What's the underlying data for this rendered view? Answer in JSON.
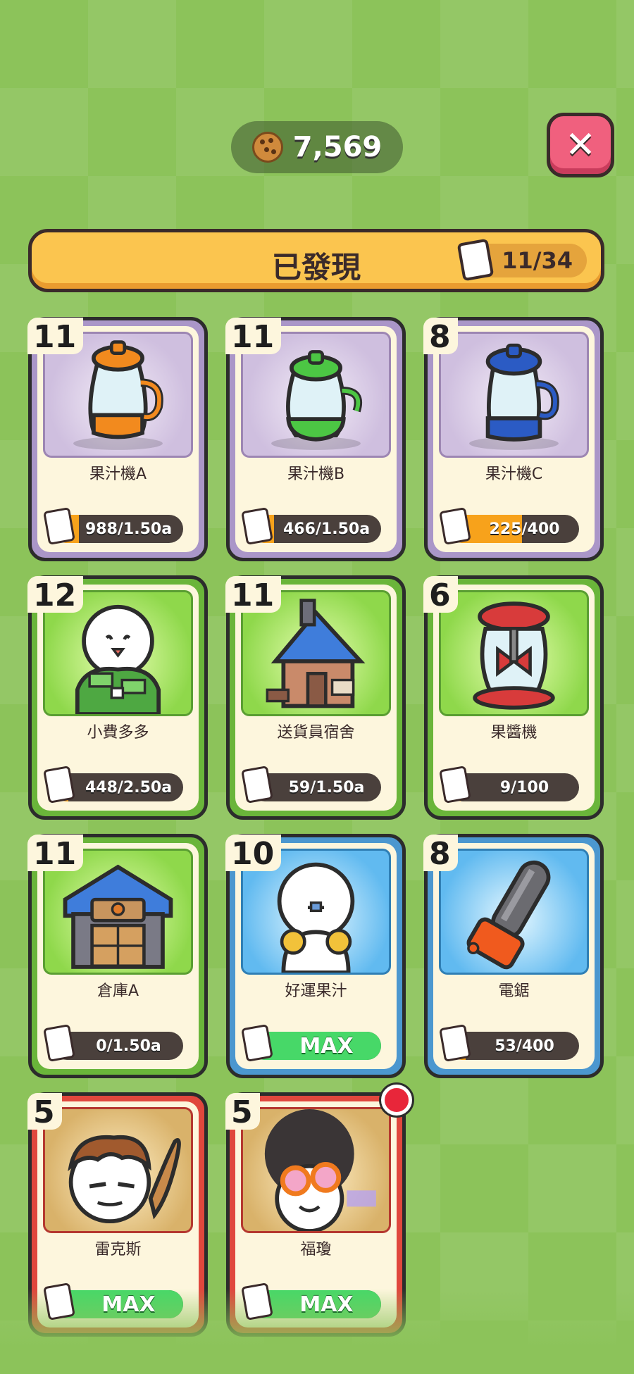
{
  "currency": {
    "icon": "cookie-icon",
    "value": "7,569"
  },
  "close_button": {
    "icon": "close-icon",
    "label": "✕"
  },
  "header": {
    "title": "已發現",
    "count": "11/34",
    "icon": "card-icon"
  },
  "colors": {
    "purple": "#aa96c8",
    "green": "#6ab53a",
    "blue": "#4b97cf",
    "red": "#e0473d",
    "progress": "#f7a21b",
    "max": "#47d868"
  },
  "cards": [
    {
      "level": "11",
      "name": "果汁機A",
      "progress_text": "988/1.50a",
      "progress": 0.2,
      "rarity": "purple",
      "icon": "juicer-orange-icon"
    },
    {
      "level": "11",
      "name": "果汁機B",
      "progress_text": "466/1.50a",
      "progress": 0.18,
      "rarity": "purple",
      "icon": "juicer-green-icon"
    },
    {
      "level": "8",
      "name": "果汁機C",
      "progress_text": "225/400",
      "progress": 0.56,
      "rarity": "purple",
      "icon": "juicer-blue-icon"
    },
    {
      "level": "12",
      "name": "小費多多",
      "progress_text": "448/2.50a",
      "progress": 0.12,
      "rarity": "green",
      "icon": "money-character-icon"
    },
    {
      "level": "11",
      "name": "送貨員宿舍",
      "progress_text": "59/1.50a",
      "progress": 0.05,
      "rarity": "green",
      "icon": "house-icon"
    },
    {
      "level": "6",
      "name": "果醬機",
      "progress_text": "9/100",
      "progress": 0.09,
      "rarity": "green",
      "icon": "jam-machine-icon"
    },
    {
      "level": "11",
      "name": "倉庫A",
      "progress_text": "0/1.50a",
      "progress": 0.0,
      "rarity": "green",
      "icon": "warehouse-icon"
    },
    {
      "level": "10",
      "name": "好運果汁",
      "progress_text": "MAX",
      "progress": 1.0,
      "rarity": "blue",
      "icon": "lucky-juice-character-icon"
    },
    {
      "level": "8",
      "name": "電鋸",
      "progress_text": "53/400",
      "progress": 0.13,
      "rarity": "blue",
      "icon": "chainsaw-icon"
    },
    {
      "level": "5",
      "name": "雷克斯",
      "progress_text": "MAX",
      "progress": 1.0,
      "rarity": "red",
      "icon": "rex-character-icon"
    },
    {
      "level": "5",
      "name": "福瓊",
      "progress_text": "MAX",
      "progress": 1.0,
      "rarity": "red",
      "icon": "fuqiong-character-icon",
      "notification": true
    }
  ]
}
